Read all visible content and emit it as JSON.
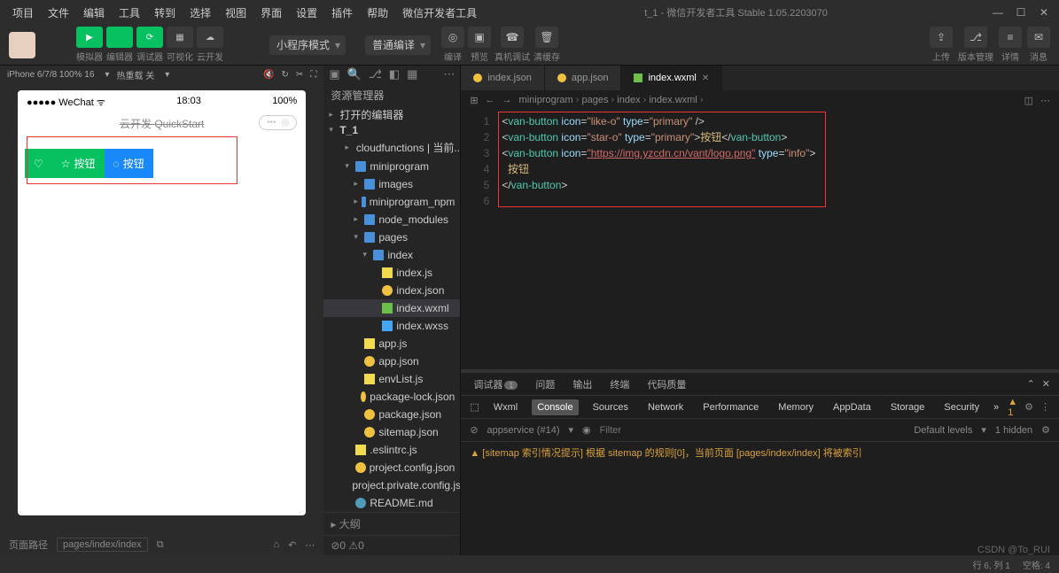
{
  "menu": [
    "项目",
    "文件",
    "编辑",
    "工具",
    "转到",
    "选择",
    "视图",
    "界面",
    "设置",
    "插件",
    "帮助",
    "微信开发者工具"
  ],
  "title": "t_1 - 微信开发者工具 Stable 1.05.2203070",
  "toolLabels": [
    "模拟器",
    "编辑器",
    "调试器",
    "可视化",
    "云开发"
  ],
  "select1": "小程序模式",
  "select2": "普通编译",
  "actionLabels": [
    "编译",
    "预览",
    "真机调试",
    "清缓存"
  ],
  "rightTools": [
    "上传",
    "版本管理",
    "详情",
    "消息"
  ],
  "sim": {
    "device": "iPhone 6/7/8 100% 16",
    "hot": "热重载 关",
    "wechat": "WeChat",
    "time": "18:03",
    "battery": "100%",
    "pageTitle": "云开发 QuickStart",
    "btn1": "按钮",
    "btn2": "按钮",
    "footerLabel": "页面路径",
    "footerPath": "pages/index/index"
  },
  "tree": {
    "title": "资源管理器",
    "open": "打开的编辑器",
    "root": "T_1",
    "items": [
      {
        "label": "cloudfunctions | 当前...",
        "ind": 2,
        "ico": "ico-folder",
        "exp": "▸"
      },
      {
        "label": "miniprogram",
        "ind": 2,
        "ico": "ico-folder",
        "exp": "▾"
      },
      {
        "label": "images",
        "ind": 3,
        "ico": "ico-folder",
        "exp": "▸"
      },
      {
        "label": "miniprogram_npm",
        "ind": 3,
        "ico": "ico-folder",
        "exp": "▸"
      },
      {
        "label": "node_modules",
        "ind": 3,
        "ico": "ico-folder",
        "exp": "▸"
      },
      {
        "label": "pages",
        "ind": 3,
        "ico": "ico-folder",
        "exp": "▾"
      },
      {
        "label": "index",
        "ind": 4,
        "ico": "ico-folder",
        "exp": "▾"
      },
      {
        "label": "index.js",
        "ind": 5,
        "ico": "ico-js",
        "exp": ""
      },
      {
        "label": "index.json",
        "ind": 5,
        "ico": "ico-json",
        "exp": ""
      },
      {
        "label": "index.wxml",
        "ind": 5,
        "ico": "ico-wxml",
        "exp": "",
        "sel": true
      },
      {
        "label": "index.wxss",
        "ind": 5,
        "ico": "ico-wxss",
        "exp": ""
      },
      {
        "label": "app.js",
        "ind": 3,
        "ico": "ico-js",
        "exp": ""
      },
      {
        "label": "app.json",
        "ind": 3,
        "ico": "ico-json",
        "exp": ""
      },
      {
        "label": "envList.js",
        "ind": 3,
        "ico": "ico-js",
        "exp": ""
      },
      {
        "label": "package-lock.json",
        "ind": 3,
        "ico": "ico-json",
        "exp": ""
      },
      {
        "label": "package.json",
        "ind": 3,
        "ico": "ico-json",
        "exp": ""
      },
      {
        "label": "sitemap.json",
        "ind": 3,
        "ico": "ico-json",
        "exp": ""
      },
      {
        "label": ".eslintrc.js",
        "ind": 2,
        "ico": "ico-js",
        "exp": ""
      },
      {
        "label": "project.config.json",
        "ind": 2,
        "ico": "ico-json",
        "exp": ""
      },
      {
        "label": "project.private.config.js...",
        "ind": 2,
        "ico": "ico-json",
        "exp": ""
      },
      {
        "label": "README.md",
        "ind": 2,
        "ico": "ico-md",
        "exp": ""
      }
    ],
    "footer": "大纲"
  },
  "tabs": [
    {
      "label": "index.json",
      "ico": "ico-json"
    },
    {
      "label": "app.json",
      "ico": "ico-json"
    },
    {
      "label": "index.wxml",
      "ico": "ico-wxml",
      "active": true
    }
  ],
  "breadcrumb": [
    "miniprogram",
    "pages",
    "index",
    "index.wxml"
  ],
  "code": {
    "l1": {
      "tag": "van-button",
      "a1": "icon",
      "v1": "like-o",
      "a2": "type",
      "v2": "primary"
    },
    "l2": {
      "tag": "van-button",
      "a1": "icon",
      "v1": "star-o",
      "a2": "type",
      "v2": "primary",
      "txt": "按钮"
    },
    "l3": {
      "tag": "van-button",
      "a1": "icon",
      "v1": "https://img.yzcdn.cn/vant/logo.png",
      "a2": "type",
      "v2": "info"
    },
    "l4": {
      "txt": "按钮"
    },
    "l5": {
      "tag": "van-button"
    }
  },
  "console": {
    "topTabs": [
      "调试器",
      "问题",
      "输出",
      "终端",
      "代码质量"
    ],
    "badge": "1",
    "subTabs": [
      "Wxml",
      "Console",
      "Sources",
      "Network",
      "Performance",
      "Memory",
      "AppData",
      "Storage",
      "Security"
    ],
    "warnCount": "1",
    "ctx": "appservice (#14)",
    "filterPh": "Filter",
    "levels": "Default levels",
    "hidden": "1 hidden",
    "msg": "[sitemap 索引情况提示] 根据 sitemap 的规则[0]，当前页面 [pages/index/index] 将被索引"
  },
  "status": {
    "errors": "0",
    "warns": "0",
    "pos": "行 6, 列 1",
    "spaces": "空格: 4",
    "watermark": "CSDN @To_RUI"
  }
}
